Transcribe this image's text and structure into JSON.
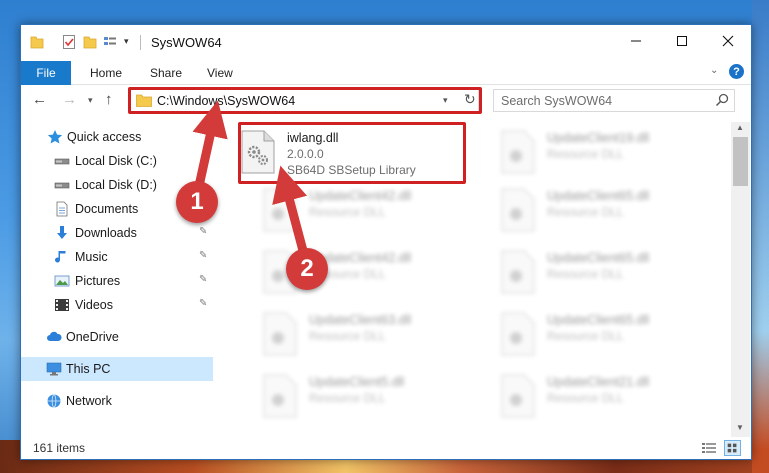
{
  "window": {
    "title": "SysWOW64",
    "minimize_glyph": "—",
    "maximize_glyph": "☐",
    "close_glyph": "✕"
  },
  "ribbon": {
    "tabs": [
      "File",
      "Home",
      "Share",
      "View"
    ],
    "expand_glyph": "⌄",
    "help_glyph": "?"
  },
  "navigation": {
    "back_glyph": "←",
    "forward_glyph": "→",
    "recent_glyph": "⌄",
    "up_glyph": "↑",
    "address": "C:\\Windows\\SysWOW64",
    "address_chevron": "⌄",
    "refresh_glyph": "↻",
    "search_placeholder": "Search SysWOW64"
  },
  "sidebar": {
    "items": [
      {
        "label": "Quick access",
        "icon": "star-icon",
        "pinned": false
      },
      {
        "label": "Local Disk (C:)",
        "icon": "drive-icon",
        "pinned": false
      },
      {
        "label": "Local Disk (D:)",
        "icon": "drive-icon",
        "pinned": false
      },
      {
        "label": "Documents",
        "icon": "documents-icon",
        "pinned": false
      },
      {
        "label": "Downloads",
        "icon": "download-icon",
        "pinned": true
      },
      {
        "label": "Music",
        "icon": "music-icon",
        "pinned": true
      },
      {
        "label": "Pictures",
        "icon": "pictures-icon",
        "pinned": true
      },
      {
        "label": "Videos",
        "icon": "videos-icon",
        "pinned": true
      },
      {
        "label": "OneDrive",
        "icon": "cloud-icon",
        "pinned": false
      },
      {
        "label": "This PC",
        "icon": "computer-icon",
        "pinned": false,
        "selected": true
      },
      {
        "label": "Network",
        "icon": "network-icon",
        "pinned": false
      }
    ],
    "pin_glyph": "📌"
  },
  "files": {
    "focused": {
      "name": "iwlang.dll",
      "version": "2.0.0.0",
      "description": "SB64D SBSetup Library"
    },
    "left_column": [
      {
        "name": "UpdateClient42.dll",
        "type": "Resource DLL"
      },
      {
        "name": "UpdateClient42.dll",
        "type": "Resource DLL"
      },
      {
        "name": "UpdateClient63.dll",
        "type": "Resource DLL"
      },
      {
        "name": "UpdateClient5.dll",
        "type": "Resource DLL"
      }
    ],
    "right_column": [
      {
        "name": "UpdateClient19.dll",
        "type": "Resource DLL"
      },
      {
        "name": "UpdateClient65.dll",
        "type": "Resource DLL"
      },
      {
        "name": "UpdateClient65.dll",
        "type": "Resource DLL"
      },
      {
        "name": "UpdateClient65.dll",
        "type": "Resource DLL"
      },
      {
        "name": "UpdateClient21.dll",
        "type": "Resource DLL"
      }
    ]
  },
  "status": {
    "item_count": "161 items"
  },
  "annotations": {
    "step1": "1",
    "step2": "2",
    "color": "#d33a3a"
  }
}
